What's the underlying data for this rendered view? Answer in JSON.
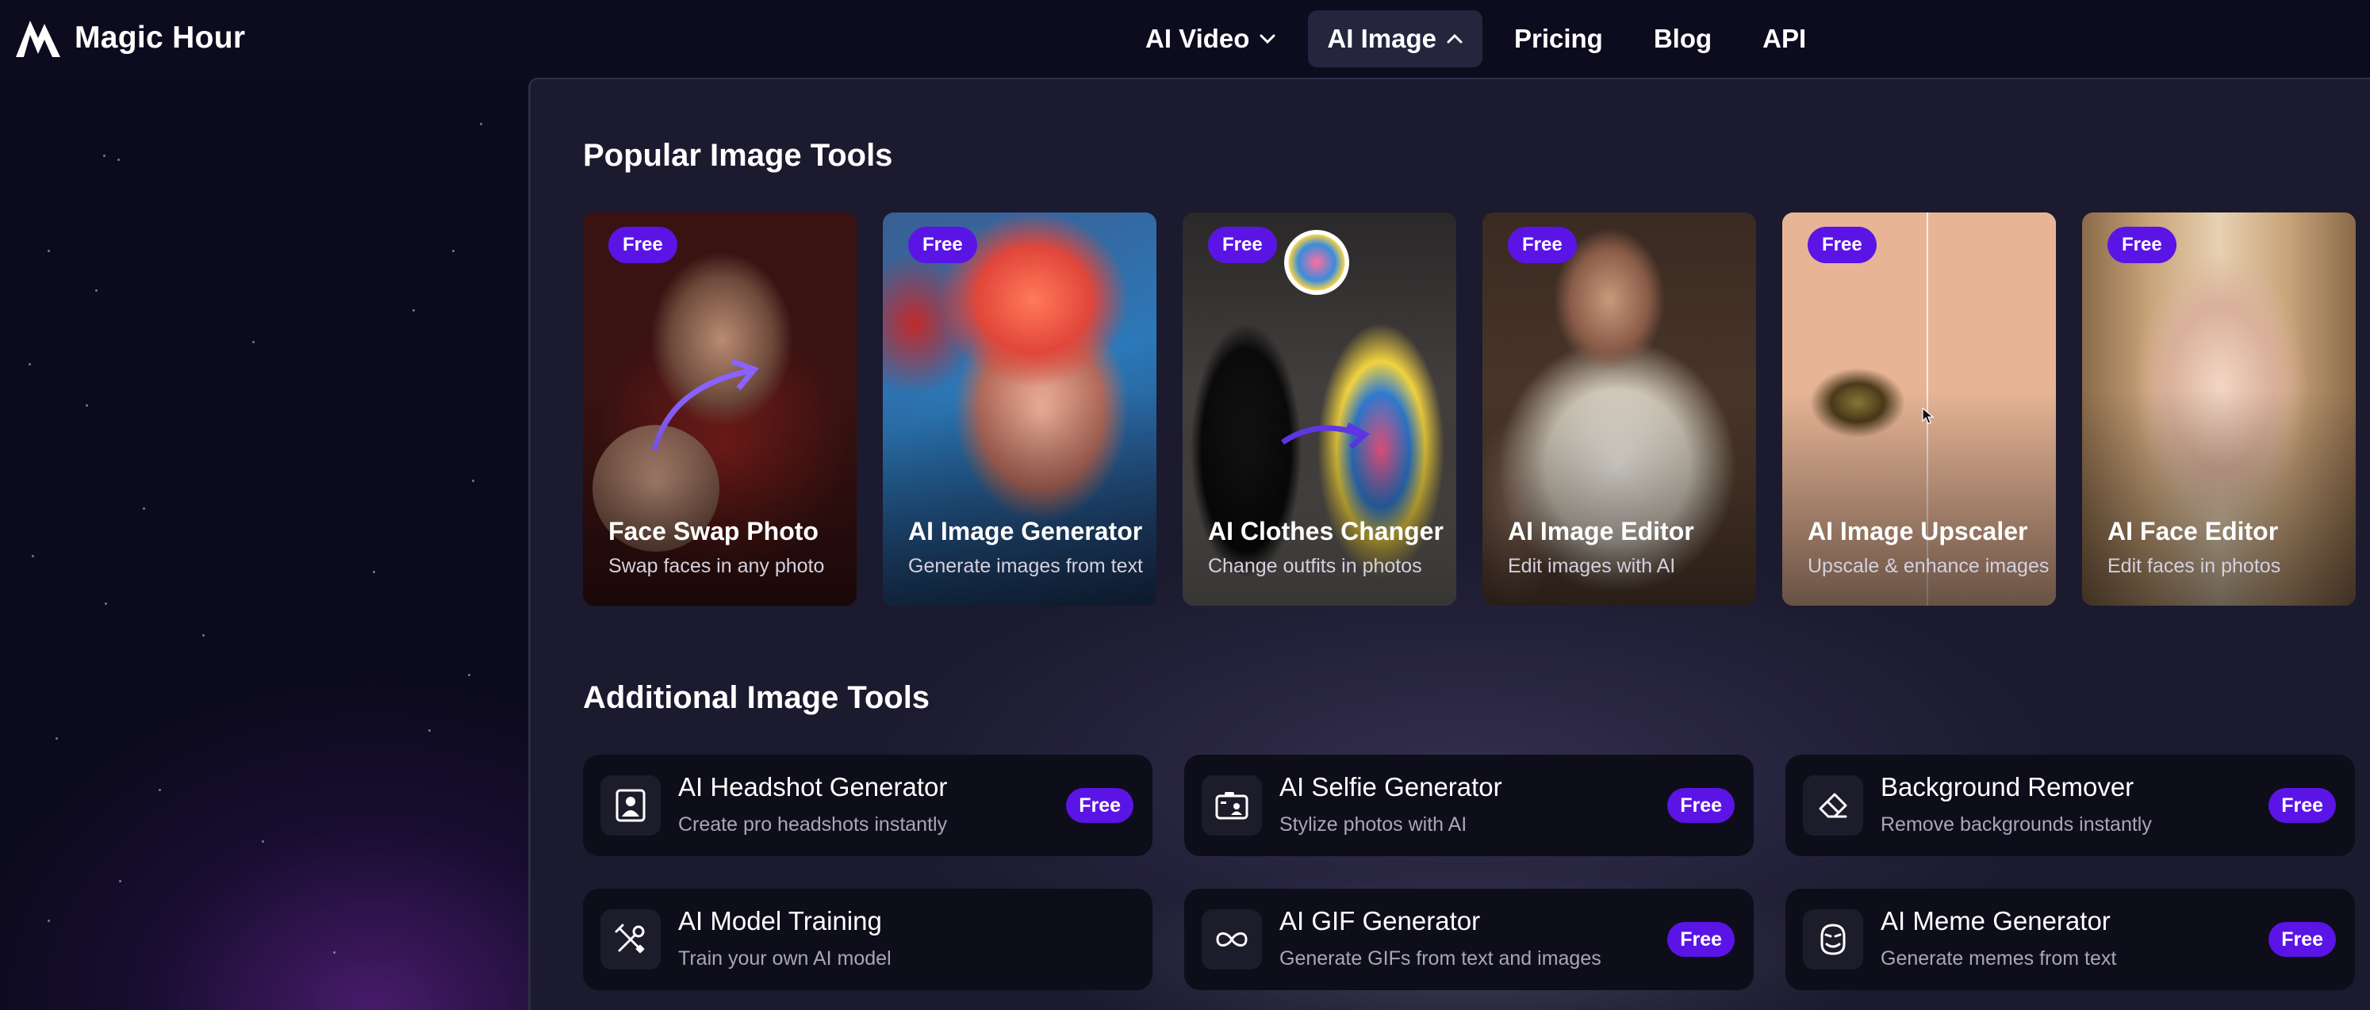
{
  "brand": {
    "name": "Magic Hour"
  },
  "nav": [
    {
      "label": "AI Video",
      "has_dropdown": true,
      "expanded": false
    },
    {
      "label": "AI Image",
      "has_dropdown": true,
      "expanded": true
    },
    {
      "label": "Pricing"
    },
    {
      "label": "Blog"
    },
    {
      "label": "API"
    }
  ],
  "popular": {
    "title": "Popular Image Tools",
    "cards": [
      {
        "badge": "Free",
        "title": "Face Swap Photo",
        "subtitle": "Swap faces in any photo"
      },
      {
        "badge": "Free",
        "title": "AI Image Generator",
        "subtitle": "Generate images from text"
      },
      {
        "badge": "Free",
        "title": "AI Clothes Changer",
        "subtitle": "Change outfits in photos"
      },
      {
        "badge": "Free",
        "title": "AI Image Editor",
        "subtitle": "Edit images with AI"
      },
      {
        "badge": "Free",
        "title": "AI Image Upscaler",
        "subtitle": "Upscale & enhance images"
      },
      {
        "badge": "Free",
        "title": "AI Face Editor",
        "subtitle": "Edit faces in photos"
      }
    ]
  },
  "additional": {
    "title": "Additional Image Tools",
    "tools": [
      {
        "title": "AI Headshot Generator",
        "subtitle": "Create pro headshots instantly",
        "badge": "Free",
        "icon": "headshot-icon"
      },
      {
        "title": "AI Selfie Generator",
        "subtitle": "Stylize photos with AI",
        "badge": "Free",
        "icon": "selfie-icon"
      },
      {
        "title": "Background Remover",
        "subtitle": "Remove backgrounds instantly",
        "badge": "Free",
        "icon": "eraser-icon"
      },
      {
        "title": "AI Model Training",
        "subtitle": "Train your own AI model",
        "badge": "",
        "icon": "tools-icon"
      },
      {
        "title": "AI GIF Generator",
        "subtitle": "Generate GIFs from text and images",
        "badge": "Free",
        "icon": "infinity-icon"
      },
      {
        "title": "AI Meme Generator",
        "subtitle": "Generate memes from text",
        "badge": "Free",
        "icon": "meme-face-icon"
      }
    ]
  },
  "colors": {
    "accent": "#5b14e6",
    "background": "#0c0b1c",
    "panel": "#1b1a2e",
    "tile": "#0e0d1a"
  }
}
